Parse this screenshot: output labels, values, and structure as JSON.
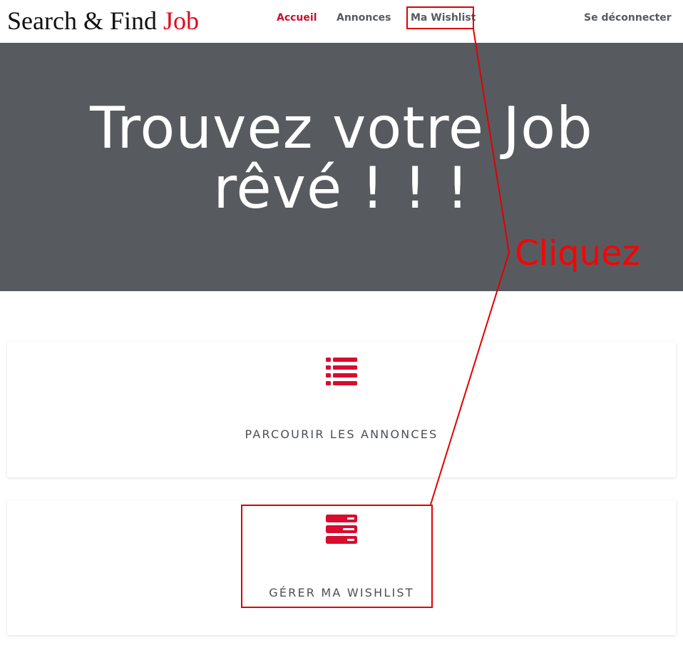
{
  "brand": {
    "main": "Search & Find",
    "accent": "Job"
  },
  "nav": {
    "home": "Accueil",
    "listings": "Annonces",
    "wishlist": "Ma Wishlist",
    "logout": "Se déconnecter"
  },
  "hero": {
    "line1": "Trouvez votre Job",
    "line2": "rêvé ! ! !"
  },
  "cards": [
    {
      "label": "PARCOURIR LES ANNONCES",
      "icon": "list-icon"
    },
    {
      "label": "GÉRER MA WISHLIST",
      "icon": "server-icon"
    }
  ],
  "annotation": {
    "text": "Cliquez"
  },
  "colors": {
    "accent": "#c8102e",
    "hero_bg": "#575b5f",
    "annotation": "#ff0000"
  }
}
